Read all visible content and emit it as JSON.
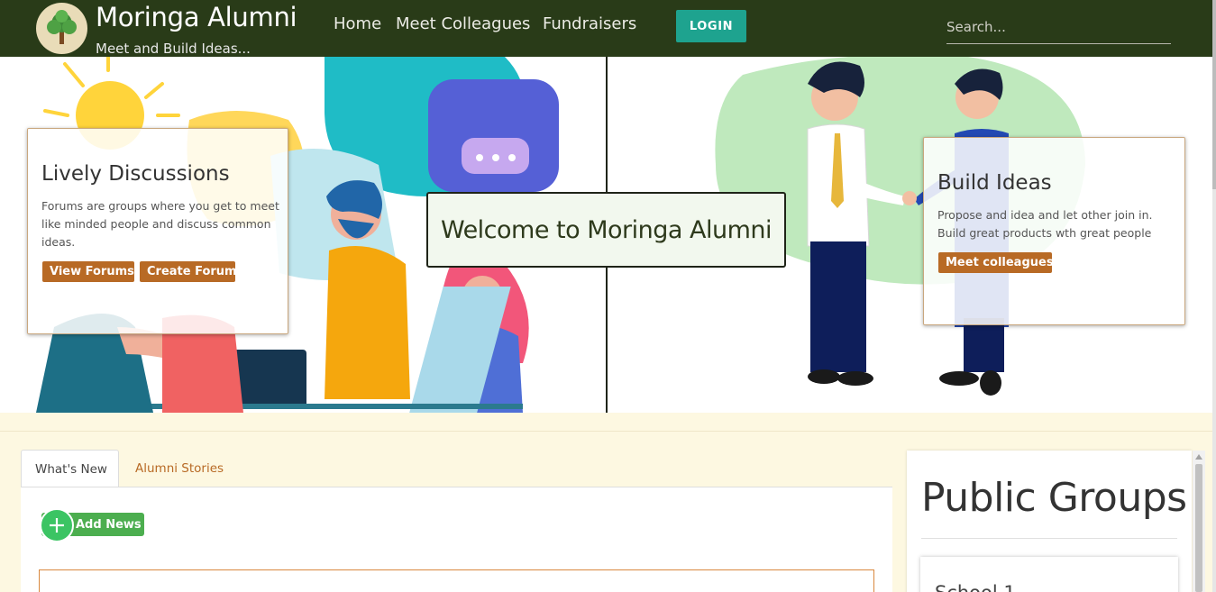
{
  "brand": {
    "title": "Moringa Alumni",
    "tagline": "Meet and Build Ideas..."
  },
  "nav": {
    "links": [
      "Home",
      "Meet Colleagues",
      "Fundraisers"
    ],
    "login_label": "LOGIN",
    "search_placeholder": "Search..."
  },
  "hero": {
    "left_card": {
      "title": "Lively Discussions",
      "text": "Forums are groups where you get to meet like minded people and discuss common ideas.",
      "buttons": [
        "View Forums",
        "Create Forum"
      ]
    },
    "welcome": "Welcome to Moringa Alumni",
    "right_card": {
      "title": "Build Ideas",
      "text": "Propose and idea and let other join in. Build great products wth great people",
      "button": "Meet colleagues"
    }
  },
  "news": {
    "tabs": [
      "What's New",
      "Alumni Stories"
    ],
    "active_tab": "What's New",
    "add_label": "Add News"
  },
  "groups": {
    "title": "Public Groups",
    "items": [
      "School 1"
    ]
  },
  "colors": {
    "navbar": "#293b18",
    "login": "#1ea38f",
    "accent_brown": "#b86a25",
    "add_green": "#4cae4f",
    "page_bg": "#fdf8e1"
  }
}
